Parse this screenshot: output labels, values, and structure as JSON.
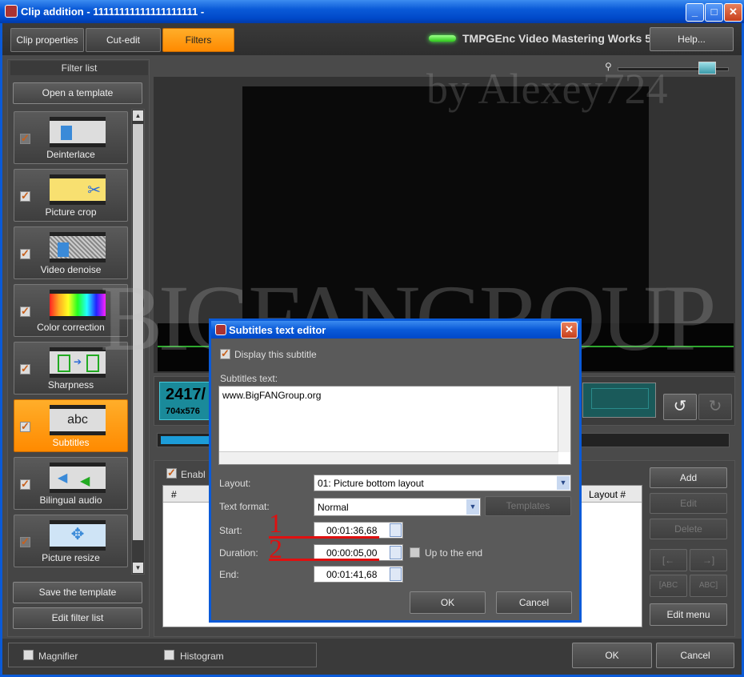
{
  "window": {
    "title": "Clip addition - 11111111111111111111 -"
  },
  "tabs": [
    {
      "label": "Clip properties"
    },
    {
      "label": "Cut-edit"
    },
    {
      "label": "Filters"
    }
  ],
  "brand": "TMPGEnc Video Mastering Works 5",
  "help_label": "Help...",
  "filter_panel": {
    "title": "Filter list",
    "open_template": "Open a template",
    "save_template": "Save the template",
    "edit_filter_list": "Edit filter list",
    "items": [
      {
        "label": "Deinterlace"
      },
      {
        "label": "Picture crop"
      },
      {
        "label": "Video denoise"
      },
      {
        "label": "Color correction"
      },
      {
        "label": "Sharpness"
      },
      {
        "label": "Subtitles",
        "thumb_text": "abc"
      },
      {
        "label": "Bilingual audio"
      },
      {
        "label": "Picture resize"
      }
    ]
  },
  "watermarks": {
    "top": "by Alexey724",
    "middle": "BIGFANGROUP"
  },
  "preview_info": {
    "frame": "2417/",
    "res": "704x576 "
  },
  "subtitle_list": {
    "enable_label": "Enabl",
    "columns": [
      "#",
      "Layout #"
    ],
    "buttons": {
      "add": "Add",
      "edit": "Edit",
      "delete": "Delete",
      "edit_menu": "Edit menu"
    }
  },
  "bottom": {
    "magnifier": "Magnifier",
    "histogram": "Histogram",
    "ok": "OK",
    "cancel": "Cancel"
  },
  "dialog": {
    "title": "Subtitles text editor",
    "display_label": "Display this subtitle",
    "text_label": "Subtitles text:",
    "text_value": "www.BigFANGroup.org",
    "layout_label": "Layout:",
    "layout_value": "01: Picture bottom layout",
    "format_label": "Text format:",
    "format_value": "Normal",
    "templates_label": "Templates",
    "start_label": "Start:",
    "start_value": "00:01:36,68",
    "duration_label": "Duration:",
    "duration_value": "00:00:05,00",
    "up_to_end": "Up to the end",
    "end_label": "End:",
    "end_value": "00:01:41,68",
    "ok": "OK",
    "cancel": "Cancel",
    "annotation_1": "1",
    "annotation_2": "2"
  }
}
